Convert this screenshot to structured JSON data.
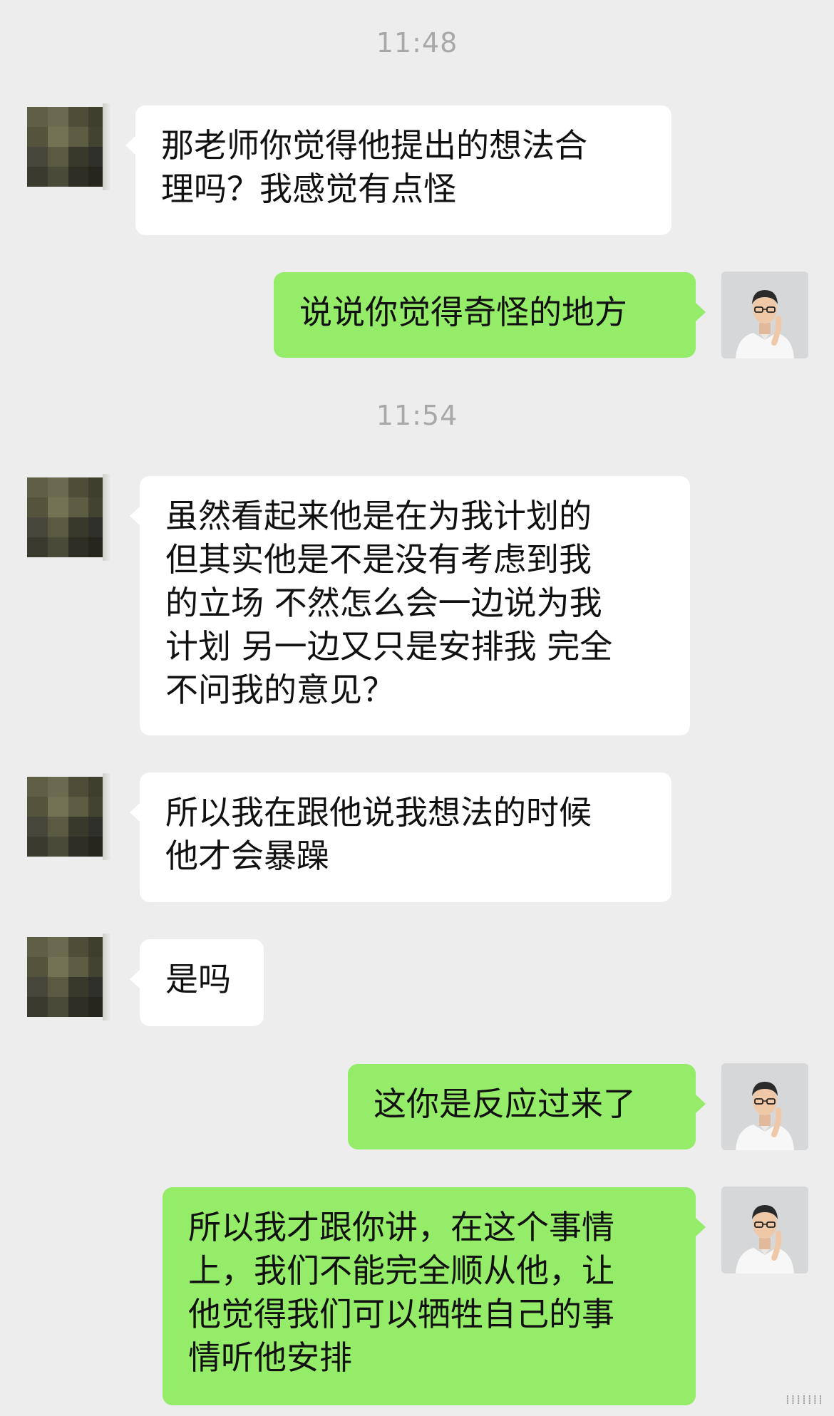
{
  "timestamps": [
    "11:48",
    "11:54"
  ],
  "messages": [
    {
      "side": "left",
      "text": "那老师你觉得他提出的想法合\n理吗？我感觉有点怪"
    },
    {
      "side": "right",
      "text": "说说你觉得奇怪的地方"
    },
    {
      "side": "left",
      "text": "虽然看起来他是在为我计划的\n但其实他是不是没有考虑到我\n的立场 不然怎么会一边说为我\n计划 另一边又只是安排我 完全\n不问我的意见？"
    },
    {
      "side": "left",
      "text": "所以我在跟他说我想法的时候\n他才会暴躁"
    },
    {
      "side": "left",
      "text": "是吗"
    },
    {
      "side": "right",
      "text": "这你是反应过来了"
    },
    {
      "side": "right",
      "text": "所以我才跟你讲，在这个事情\n上，我们不能完全顺从他，让\n他觉得我们可以牺牲自己的事\n情听他安排"
    }
  ],
  "avatars": {
    "left_icon": "pixelated-avatar-icon",
    "right_icon": "teacher-photo-avatar-icon"
  },
  "colors": {
    "background": "#ededed",
    "left_bubble": "#ffffff",
    "right_bubble": "#95ec69",
    "timestamp": "#a8a8a8"
  }
}
